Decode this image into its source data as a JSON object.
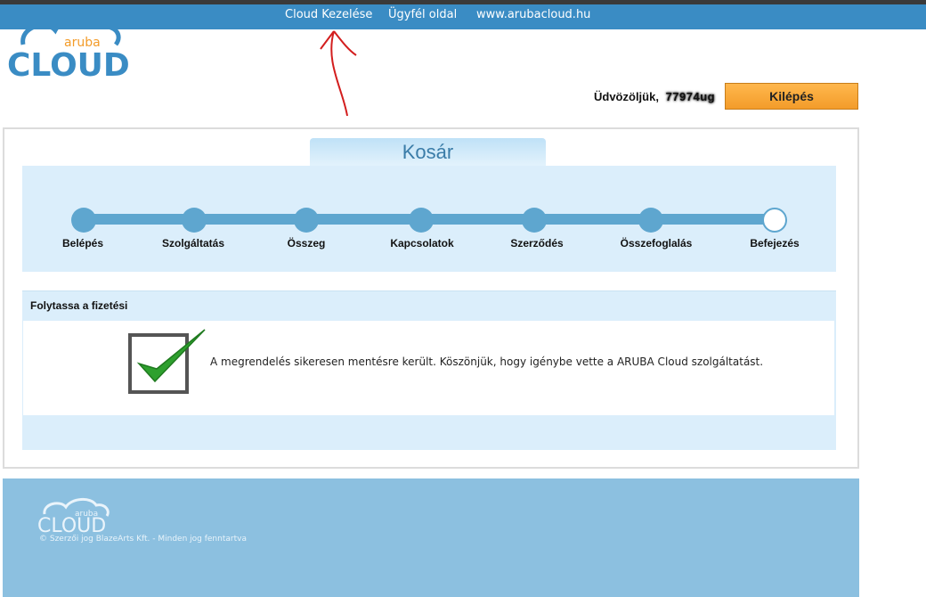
{
  "nav": {
    "items": [
      "Cloud Kezelése",
      "Ügyfél oldal",
      "www.arubacloud.hu"
    ]
  },
  "logo": {
    "small_text": "aruba",
    "big_text": "CLOUD"
  },
  "header": {
    "welcome_label": "Üdvözöljük,",
    "username": "77974ug",
    "logout_label": "Kilépés"
  },
  "cart": {
    "title": "Kosár",
    "steps": [
      "Belépés",
      "Szolgáltatás",
      "Összeg",
      "Kapcsolatok",
      "Szerződés",
      "Összefoglalás",
      "Befejezés"
    ],
    "current_step": 7
  },
  "payment": {
    "header": "Folytassa a fizetési",
    "message": "A megrendelés sikeresen mentésre került. Köszönjük, hogy igénybe vette a ARUBA Cloud szolgáltatást."
  },
  "footer": {
    "logo_small": "aruba",
    "logo_big": "CLOUD",
    "copyright": "© Szerzői jog BlazeArts Kft. - Minden jog fenntartva"
  },
  "colors": {
    "nav_bg": "#3a8cc4",
    "accent_orange": "#f39c2a",
    "step_blue": "#5ea6cf",
    "panel_bg": "#dbeefb",
    "footer_bg": "#8cc0e0",
    "check_green": "#2ea02e"
  }
}
